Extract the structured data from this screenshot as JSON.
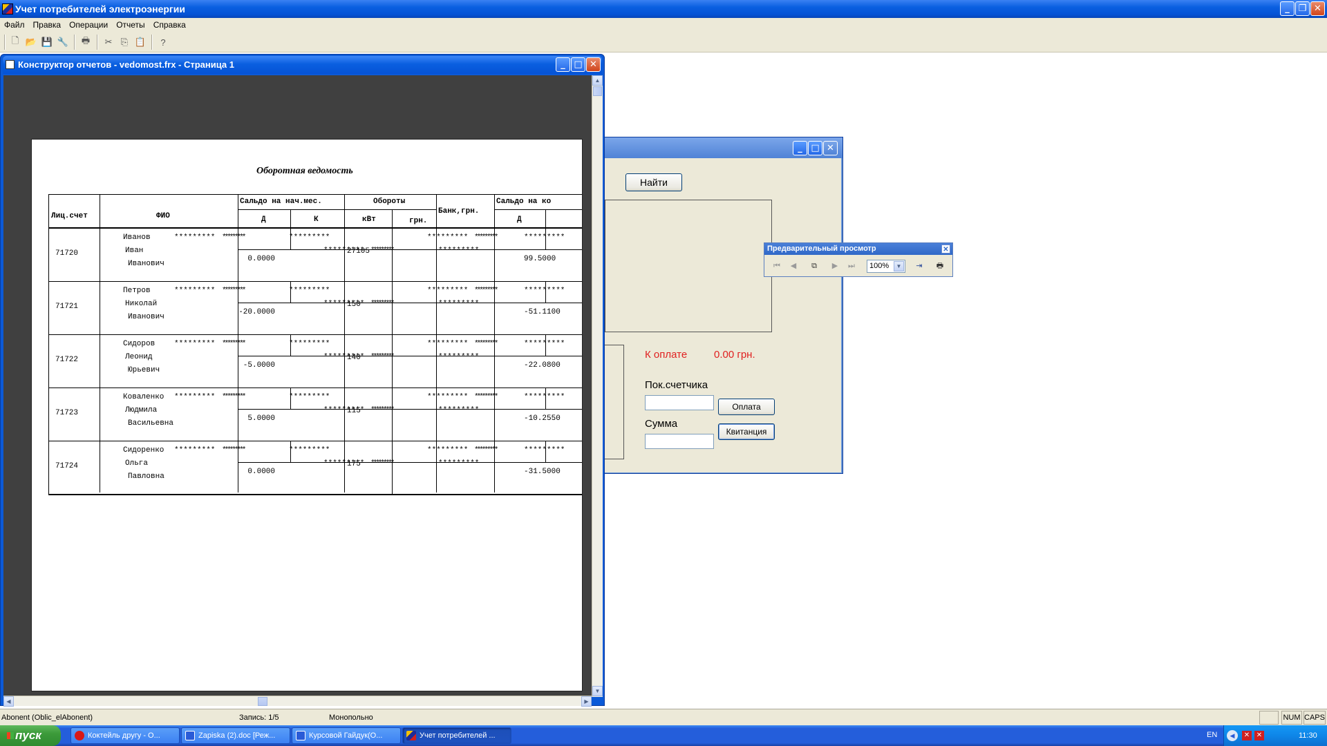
{
  "app": {
    "title": "Учет потребителей электроэнергии"
  },
  "menu": [
    "Файл",
    "Правка",
    "Операции",
    "Отчеты",
    "Справка"
  ],
  "report_window": {
    "title": "Конструктор отчетов - vedomost.frx - Страница 1"
  },
  "report": {
    "title": "Оборотная ведомость",
    "headers": {
      "account": "Лиц.счет",
      "fio": "ФИО",
      "saldo_start": "Сальдо на нач.мес.",
      "turnover": "Обороты",
      "bank": "Банк,грн.",
      "saldo_end": "Сальдо на ко",
      "d": "Д",
      "k": "К",
      "kwt": "кВт",
      "grn": "грн.",
      "d2": "Д"
    },
    "stars": "*********",
    "rows": [
      {
        "account": "71720",
        "fio": [
          "Иванов",
          "Иван",
          "Иванович"
        ],
        "saldo": "0.0000",
        "kwt": "27105",
        "end": "99.5000"
      },
      {
        "account": "71721",
        "fio": [
          "Петров",
          "Николай",
          "Иванович"
        ],
        "saldo": "-20.0000",
        "kwt": "150",
        "end": "-51.1100"
      },
      {
        "account": "71722",
        "fio": [
          "Сидоров",
          "Леонид",
          "Юрьевич"
        ],
        "saldo": "-5.0000",
        "kwt": "140",
        "end": "-22.0800"
      },
      {
        "account": "71723",
        "fio": [
          "Коваленко",
          "Людмила",
          "Васильевна"
        ],
        "saldo": "5.0000",
        "kwt": "115",
        "end": "-10.2550"
      },
      {
        "account": "71724",
        "fio": [
          "Сидоренко",
          "Ольга",
          "Павловна"
        ],
        "saldo": "0.0000",
        "kwt": "175",
        "end": "-31.5000"
      }
    ]
  },
  "form": {
    "find_label": "Найти",
    "pay_due_label": "К оплате",
    "pay_due_value": "0.00 грн.",
    "meter_label": "Пок.счетчика",
    "sum_label": "Сумма",
    "pay_button": "Оплата",
    "receipt_button": "Квитанция"
  },
  "preview": {
    "title": "Предварительный просмотр",
    "zoom": "100%"
  },
  "status": {
    "table": "Abonent (Oblic_elAbonent)",
    "record": "Запись: 1/5",
    "mode": "Монопольно",
    "num": "NUM",
    "caps": "CAPS"
  },
  "taskbar": {
    "start": "пуск",
    "tasks": [
      {
        "label": "Коктейль другу - O...",
        "color": "#d81818"
      },
      {
        "label": "Zapiska (2).doc [Реж...",
        "color": "#2a5bd7"
      },
      {
        "label": "Курсовой Гайдук(О...",
        "color": "#2a5bd7"
      },
      {
        "label": "Учет потребителей ...",
        "color": "#1c2c9a"
      }
    ],
    "lang": "EN",
    "time": "11:30"
  }
}
